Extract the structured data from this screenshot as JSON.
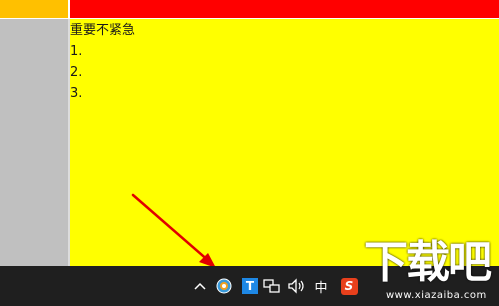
{
  "note": {
    "title": "重要不紧急",
    "items": [
      "1.",
      "2.",
      "3."
    ]
  },
  "taskbar": {
    "chevron": "^",
    "ime_label": "中",
    "sogou_label": "S",
    "t_label": "T"
  },
  "watermark": {
    "logo_text": "下载吧",
    "url": "www.xiazaiba.com"
  },
  "colors": {
    "note_background": "#ffff00",
    "header_red": "#ff0000",
    "header_orange": "#ffc000",
    "sidebar_gray": "#c0c0c0",
    "taskbar": "#1f1f1f",
    "arrow": "#e00000"
  },
  "icons": [
    "chevron-up-icon",
    "browser-icon",
    "t-app-icon",
    "network-icon",
    "volume-icon",
    "sogou-icon"
  ]
}
